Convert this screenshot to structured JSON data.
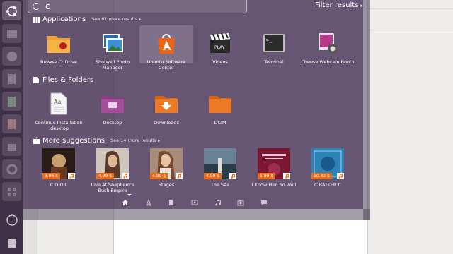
{
  "search": {
    "query": "c"
  },
  "filter": {
    "label": "Filter results"
  },
  "sections": {
    "applications": {
      "title": "Applications",
      "more": "See 61 more results",
      "items": [
        {
          "label": "Browse C: Drive",
          "icon": "folder-wine-icon"
        },
        {
          "label": "Shotwell Photo Manager",
          "icon": "shotwell-icon"
        },
        {
          "label": "Ubuntu Software Center",
          "icon": "software-center-icon"
        },
        {
          "label": "Videos",
          "icon": "clapperboard-icon"
        },
        {
          "label": "Terminal",
          "icon": "terminal-icon"
        },
        {
          "label": "Cheese Webcam Booth",
          "icon": "webcam-icon"
        }
      ]
    },
    "files": {
      "title": "Files & Folders",
      "items": [
        {
          "label": "Continue Installation .desktop",
          "icon": "desktop-file-icon"
        },
        {
          "label": "Desktop",
          "icon": "desktop-folder-icon"
        },
        {
          "label": "Downloads",
          "icon": "downloads-folder-icon"
        },
        {
          "label": "DCIM",
          "icon": "folder-icon"
        }
      ]
    },
    "suggestions": {
      "title": "More suggestions",
      "more": "See 14 more results",
      "items": [
        {
          "label": "C O O L",
          "price": "3.96 $",
          "cover": "#2a1c16"
        },
        {
          "label": "Live At Shepherd's Bush Empire",
          "price": "4.99 $",
          "cover": "#cfc6bc"
        },
        {
          "label": "Stages",
          "price": "4.99 $",
          "cover": "#a88c7a"
        },
        {
          "label": "The Sea",
          "price": "4.99 $",
          "cover": "#3f5566"
        },
        {
          "label": "I Know Him So Well",
          "price": "1.99 $",
          "cover": "#7a1834"
        },
        {
          "label": "C BATTER C",
          "price": "10.32 $",
          "cover": "#2d82b8"
        }
      ]
    }
  },
  "lenses": [
    "home-lens-icon",
    "applications-lens-icon",
    "files-lens-icon",
    "video-lens-icon",
    "music-lens-icon",
    "photo-lens-icon",
    "social-lens-icon"
  ],
  "colors": {
    "accent": "#e86b1a",
    "dash": "#4e3a5c",
    "launcher": "#3f3147"
  }
}
